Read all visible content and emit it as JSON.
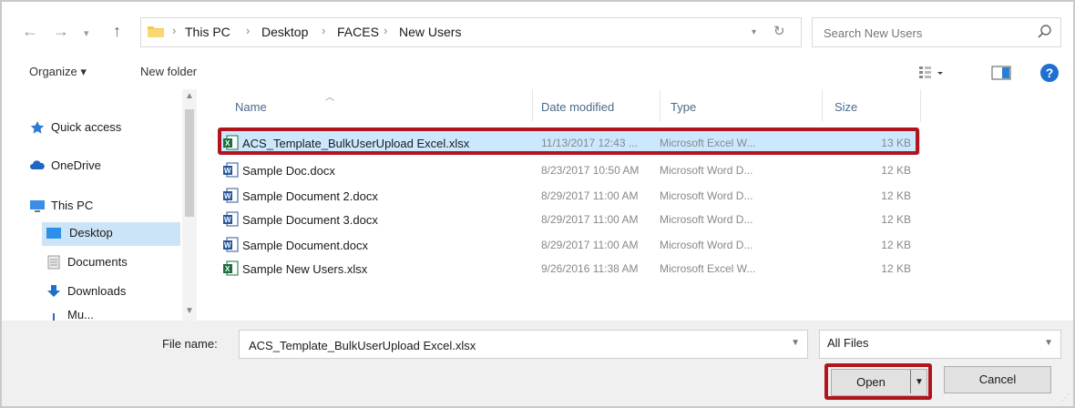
{
  "breadcrumb": [
    "This PC",
    "Desktop",
    "FACES",
    "New Users"
  ],
  "search": {
    "placeholder": "Search New Users"
  },
  "toolbar": {
    "organize_label": "Organize ▾",
    "new_folder_label": "New folder"
  },
  "nav": {
    "items": [
      {
        "label": "Quick access",
        "icon": "star-icon"
      },
      {
        "label": "OneDrive",
        "icon": "cloud-icon"
      },
      {
        "label": "This PC",
        "icon": "computer-icon"
      },
      {
        "label": "Desktop",
        "icon": "desktop-icon",
        "selected": true
      },
      {
        "label": "Documents",
        "icon": "documents-icon"
      },
      {
        "label": "Downloads",
        "icon": "download-icon"
      },
      {
        "label": "Mu...",
        "icon": "music-icon"
      }
    ]
  },
  "columns": [
    "Name",
    "Date modified",
    "Type",
    "Size"
  ],
  "files": [
    {
      "name": "ACS_Template_BulkUserUpload Excel.xlsx",
      "date": "11/13/2017 12:43 ...",
      "type": "Microsoft Excel W...",
      "size": "13 KB",
      "icon": "excel-icon",
      "selected": true
    },
    {
      "name": "Sample Doc.docx",
      "date": "8/23/2017 10:50 AM",
      "type": "Microsoft Word D...",
      "size": "12 KB",
      "icon": "word-icon"
    },
    {
      "name": "Sample Document 2.docx",
      "date": "8/29/2017 11:00 AM",
      "type": "Microsoft Word D...",
      "size": "12 KB",
      "icon": "word-icon"
    },
    {
      "name": "Sample Document 3.docx",
      "date": "8/29/2017 11:00 AM",
      "type": "Microsoft Word D...",
      "size": "12 KB",
      "icon": "word-icon"
    },
    {
      "name": "Sample Document.docx",
      "date": "8/29/2017 11:00 AM",
      "type": "Microsoft Word D...",
      "size": "12 KB",
      "icon": "word-icon"
    },
    {
      "name": "Sample New Users.xlsx",
      "date": "9/26/2016 11:38 AM",
      "type": "Microsoft Excel W...",
      "size": "12 KB",
      "icon": "excel-icon"
    }
  ],
  "footer": {
    "file_name_label": "File name:",
    "file_name_value": "ACS_Template_BulkUserUpload Excel.xlsx",
    "file_type": "All Files",
    "open_label": "Open",
    "cancel_label": "Cancel"
  },
  "colors": {
    "highlight": "#b0151e",
    "selection": "#cce8ff",
    "accent": "#1f6fd0"
  }
}
